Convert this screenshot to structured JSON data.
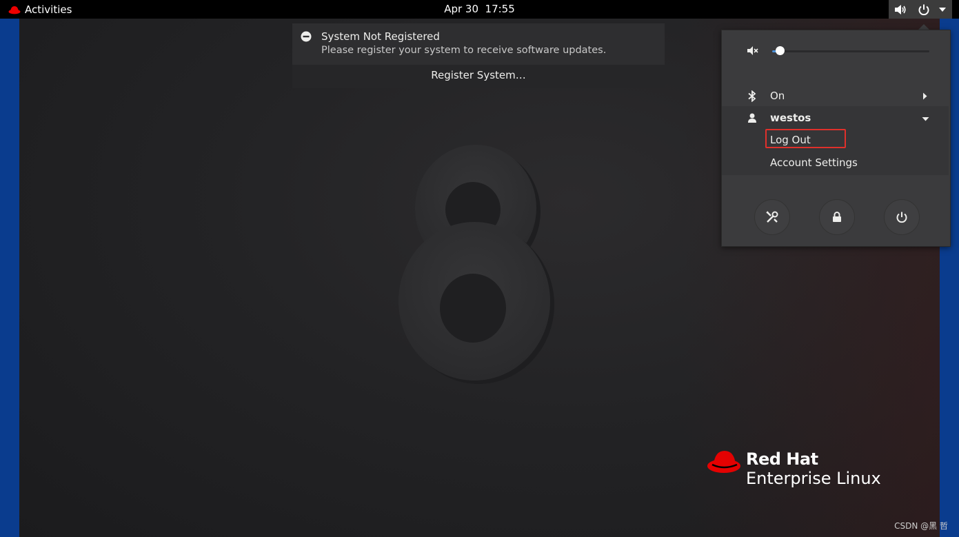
{
  "topbar": {
    "activities_label": "Activities",
    "clock": "Apr 30  17:55"
  },
  "notification": {
    "title": "System Not Registered",
    "body": "Please register your system to receive software updates.",
    "action_label": "Register System…"
  },
  "system_menu": {
    "volume_level": 0.05,
    "bluetooth_label": "On",
    "user_name": "westos",
    "logout_label": "Log Out",
    "account_settings_label": "Account Settings",
    "buttons": [
      "settings-icon",
      "lock-icon",
      "power-icon"
    ]
  },
  "branding": {
    "line1": "Red Hat",
    "line2": "Enterprise Linux"
  },
  "watermark": "CSDN @黑 哲",
  "colors": {
    "topbar": "#000000",
    "desktop": "#232325",
    "menu": "#3b3b3d",
    "accent": "#4a90d9",
    "highlight": "#e0302b",
    "redhat": "#ee0000"
  }
}
